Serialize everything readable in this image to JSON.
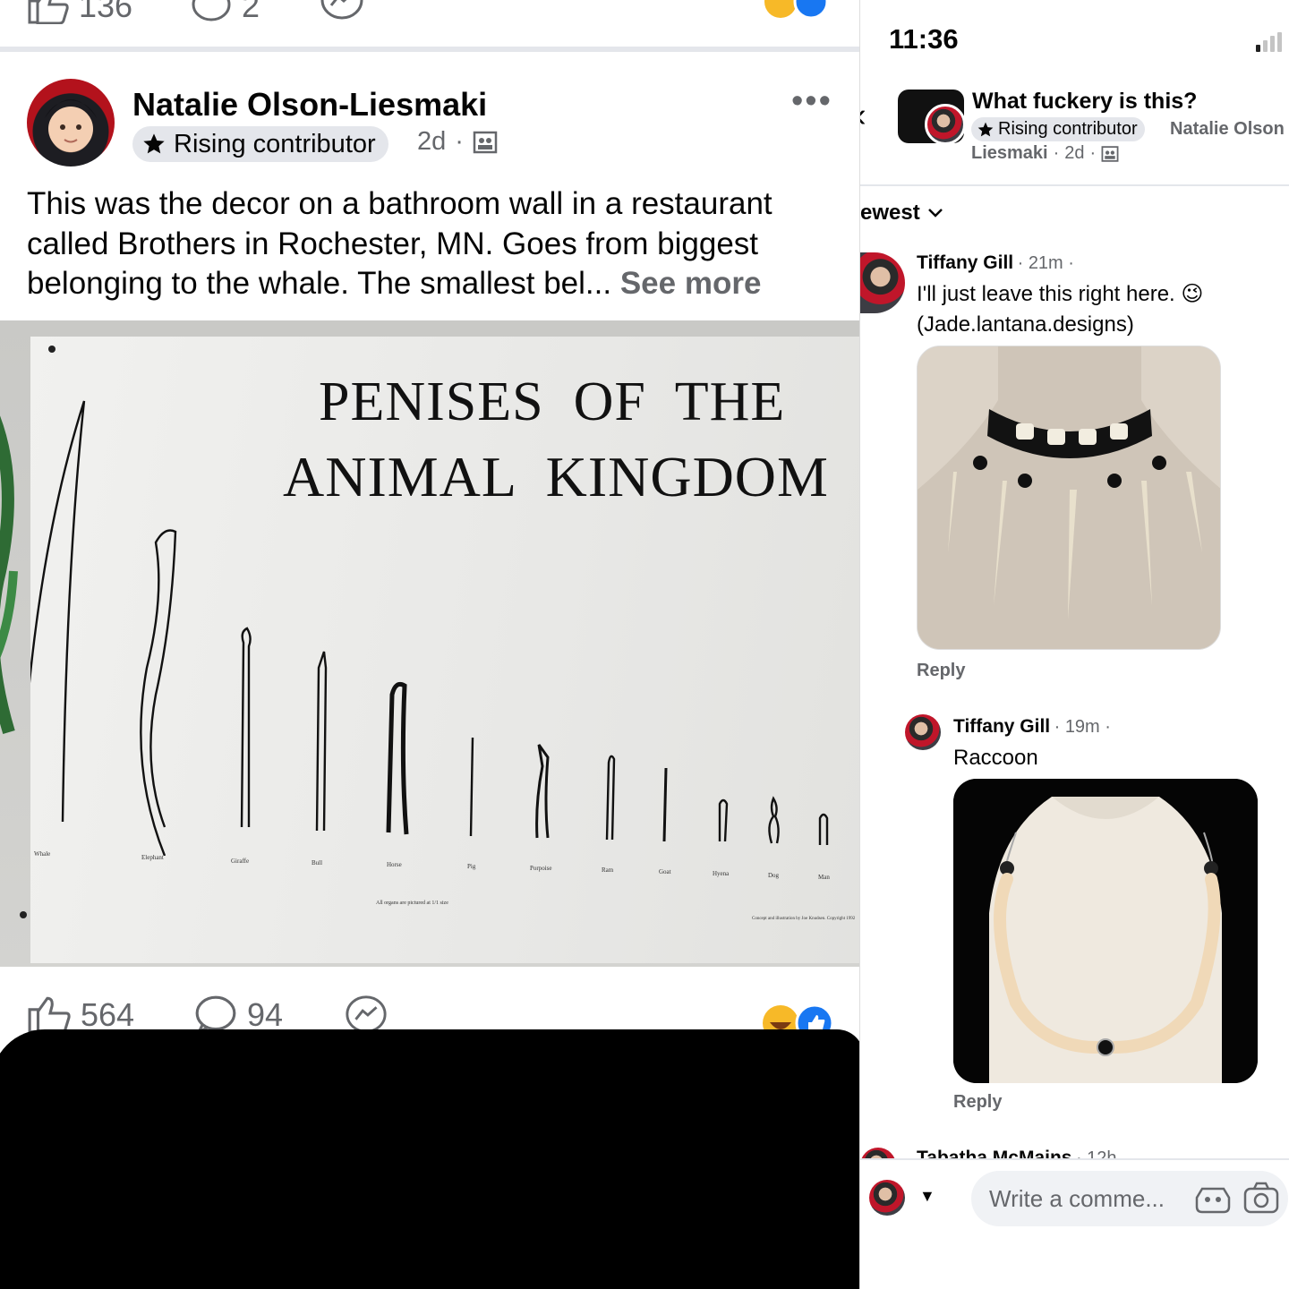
{
  "left": {
    "top_stats": {
      "likes": "136",
      "comments": "2"
    },
    "author": {
      "name": "Natalie Olson-Liesmaki",
      "badge": "Rising contributor",
      "age": "2d",
      "dot": "·"
    },
    "post": {
      "text": "This was the decor on a bathroom wall in a restaurant called Brothers in Rochester, MN. Goes from biggest belonging to the whale. The smallest bel...",
      "see_more": "See more"
    },
    "poster": {
      "title_line1": "PENISES  OF  THE",
      "title_line2": "ANIMAL  KINGDOM",
      "labels": [
        "Whale",
        "Elephant",
        "Giraffe",
        "Bull",
        "Horse",
        "Pig",
        "Porpoise",
        "Ram",
        "Goat",
        "Hyena",
        "Dog",
        "Man"
      ],
      "footnote": "All organs are pictured at 1/1 size",
      "credit": "Concept and illustration by Joe Knudsen. Copyright 1992"
    },
    "stats": {
      "likes": "564",
      "comments": "94"
    }
  },
  "right": {
    "time": "11:36",
    "post_title": "What fuckery is this?",
    "badge": "Rising contributor",
    "author_first": "Natalie Olson",
    "author_rest": "Liesmaki",
    "age": "2d",
    "dot": "·",
    "sort_label": "ewest",
    "comments": [
      {
        "name": "Tiffany Gill",
        "time": "21m",
        "line1": "I'll just leave this right here. 😉",
        "line2": "(Jade.lantana.designs)",
        "reply": "Reply"
      },
      {
        "name": "Tiffany Gill",
        "time": "19m",
        "line1": "Raccoon",
        "reply": "Reply"
      }
    ],
    "next_name": "Tabatha McMains",
    "next_time": "12h",
    "compose_placeholder": "Write a comme..."
  },
  "colors": {
    "fb_blue": "#1877f2",
    "secondary_text": "#65676b",
    "chip_bg": "#e4e6eb"
  }
}
